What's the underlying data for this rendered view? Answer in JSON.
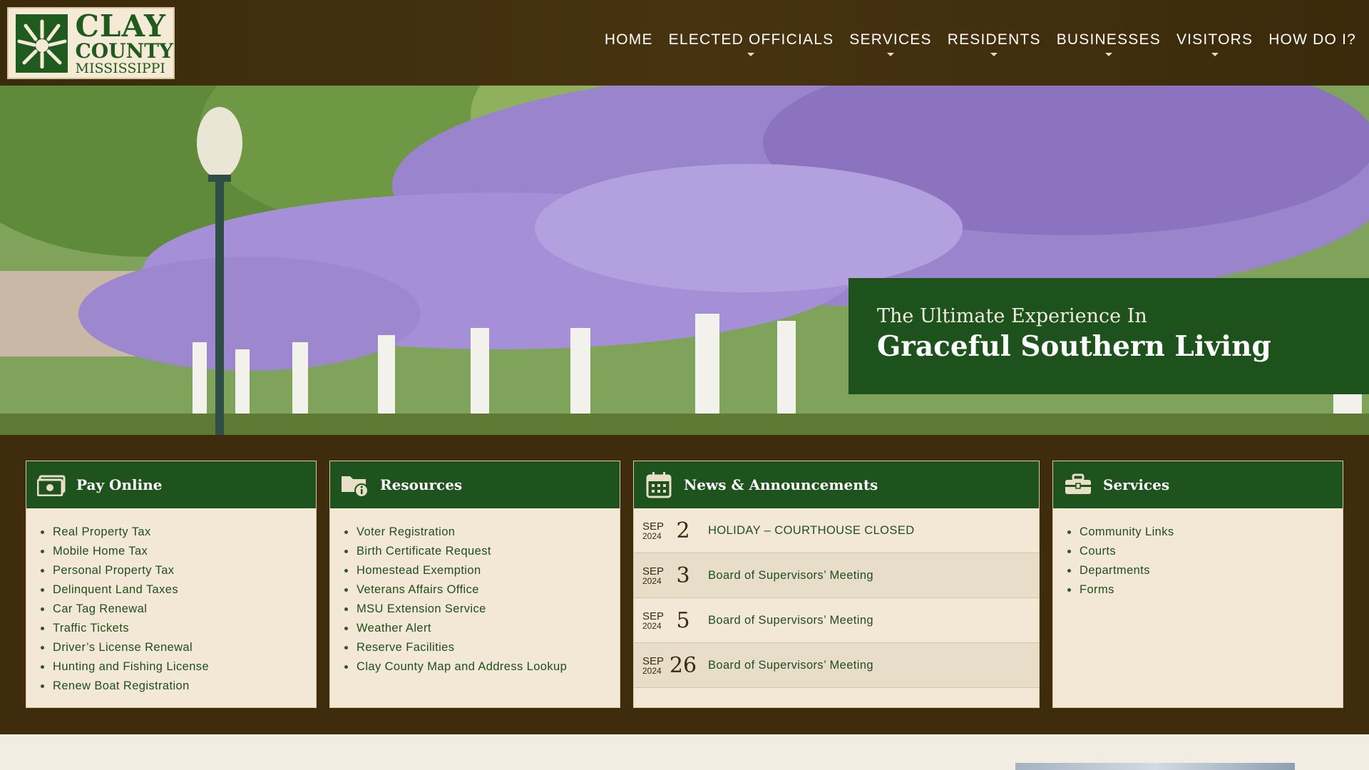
{
  "header": {
    "logo": {
      "line1": "CLAY",
      "line2": "COUNTY",
      "line3": "MISSISSIPPI"
    },
    "nav": [
      {
        "label": "HOME",
        "dropdown": false
      },
      {
        "label": "ELECTED OFFICIALS",
        "dropdown": true
      },
      {
        "label": "SERVICES",
        "dropdown": true
      },
      {
        "label": "RESIDENTS",
        "dropdown": true
      },
      {
        "label": "BUSINESSES",
        "dropdown": true
      },
      {
        "label": "VISITORS",
        "dropdown": true
      },
      {
        "label": "HOW DO I?",
        "dropdown": false
      }
    ]
  },
  "hero": {
    "subtitle": "The Ultimate Experience In",
    "title": "Graceful Southern Living"
  },
  "cards": {
    "pay_online": {
      "title": "Pay Online",
      "icon": "money-icon",
      "items": [
        "Real Property Tax",
        "Mobile Home Tax",
        "Personal Property Tax",
        "Delinquent Land Taxes",
        "Car Tag Renewal",
        "Traffic Tickets",
        "Driver’s License Renewal",
        "Hunting and Fishing License",
        "Renew Boat Registration"
      ]
    },
    "resources": {
      "title": "Resources",
      "icon": "folder-info-icon",
      "items": [
        "Voter Registration",
        "Birth Certificate Request",
        "Homestead Exemption",
        "Veterans Affairs Office",
        "MSU Extension Service",
        "Weather Alert",
        "Reserve Facilities",
        "Clay County Map and Address Lookup"
      ]
    },
    "news": {
      "title": "News & Announcements",
      "icon": "calendar-icon",
      "items": [
        {
          "month": "SEP",
          "year": "2024",
          "day": "2",
          "text": "HOLIDAY – COURTHOUSE CLOSED"
        },
        {
          "month": "SEP",
          "year": "2024",
          "day": "3",
          "text": "Board of Supervisors’ Meeting"
        },
        {
          "month": "SEP",
          "year": "2024",
          "day": "5",
          "text": "Board of Supervisors’ Meeting"
        },
        {
          "month": "SEP",
          "year": "2024",
          "day": "26",
          "text": "Board of Supervisors’ Meeting"
        }
      ]
    },
    "services": {
      "title": "Services",
      "icon": "toolbox-icon",
      "items": [
        "Community Links",
        "Courts",
        "Departments",
        "Forms"
      ]
    }
  },
  "colors": {
    "brown": "#3f2c0c",
    "green": "#1e531e",
    "cream": "#f2e8d5"
  }
}
